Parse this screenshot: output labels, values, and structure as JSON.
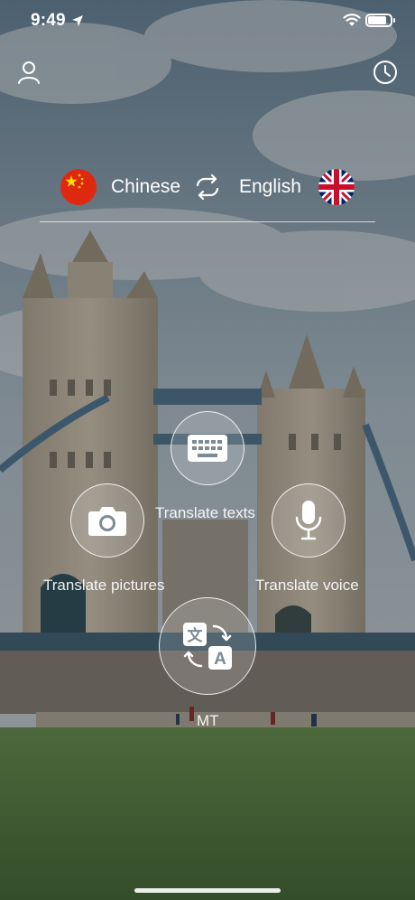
{
  "status_bar": {
    "time": "9:49",
    "battery_level": 0.85
  },
  "header": {
    "profile_icon": "person-icon",
    "history_icon": "clock-history-icon"
  },
  "language": {
    "source": "Chinese",
    "target": "English",
    "source_flag": "china-flag-icon",
    "target_flag": "uk-flag-icon",
    "swap_icon": "swap-arrows-icon"
  },
  "actions": {
    "texts": "Translate texts",
    "pictures": "Translate pictures",
    "voice": "Translate voice",
    "mt": "MT"
  },
  "colors": {
    "accent": "#ffffff",
    "china_red": "#de2910",
    "uk_blue": "#012169",
    "uk_red": "#c8102e"
  }
}
